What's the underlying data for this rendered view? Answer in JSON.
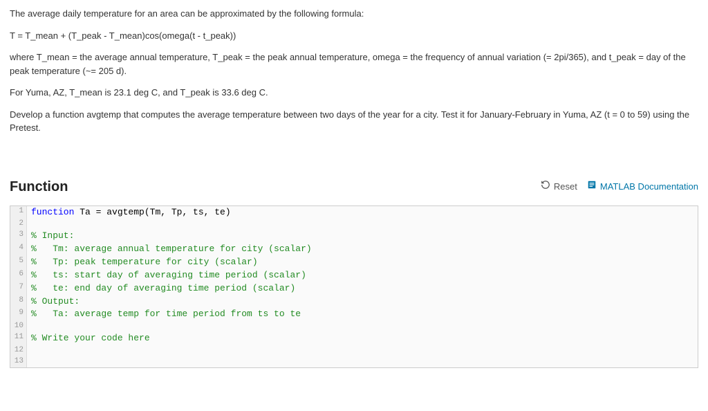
{
  "problem": {
    "p1": "The average daily temperature for an area can be approximated by the following formula:",
    "p2": "T = T_mean + (T_peak - T_mean)cos(omega(t - t_peak))",
    "p3": "where T_mean = the average annual temperature, T_peak = the peak annual temperature, omega = the frequency of annual variation (= 2pi/365), and t_peak = day of the peak temperature (~= 205 d).",
    "p4": "For Yuma, AZ, T_mean is 23.1 deg C, and T_peak is 33.6 deg C.",
    "p5": "Develop a function avgtemp that computes the average temperature between two days of the year for a city. Test it for January-February in Yuma, AZ (t = 0 to 59) using the Pretest."
  },
  "section": {
    "title": "Function",
    "reset_label": "Reset",
    "doc_label": "MATLAB Documentation"
  },
  "code": {
    "l1a": "function",
    "l1b": " Ta = avgtemp(Tm, Tp, ts, te)",
    "l2": "",
    "l3": "% Input:",
    "l4": "%   Tm: average annual temperature for city (scalar)",
    "l5": "%   Tp: peak temperature for city (scalar)",
    "l6": "%   ts: start day of averaging time period (scalar)",
    "l7": "%   te: end day of averaging time period (scalar)",
    "l8": "% Output:",
    "l9": "%   Ta: average temp for time period from ts to te",
    "l10": "",
    "l11": "% Write your code here",
    "l12": "",
    "l13": ""
  }
}
